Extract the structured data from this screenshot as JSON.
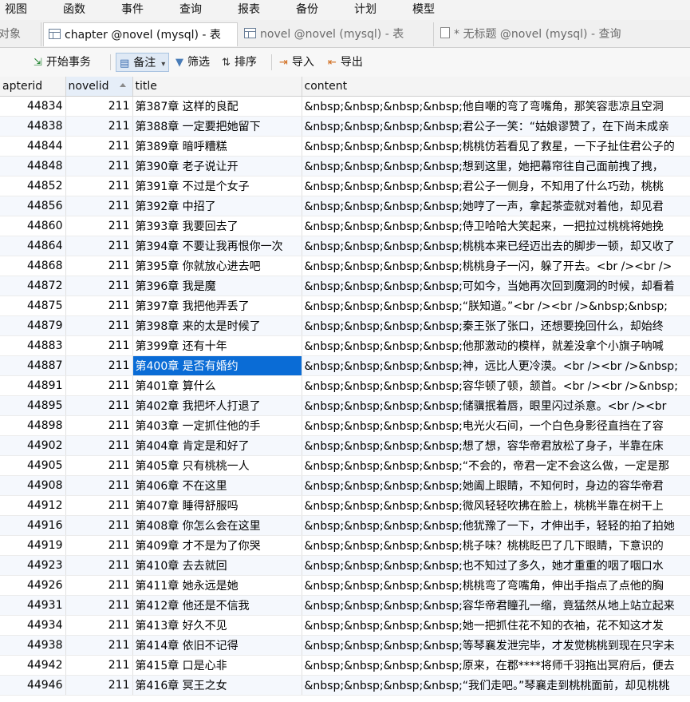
{
  "menu": [
    "视图",
    "函数",
    "事件",
    "查询",
    "报表",
    "备份",
    "计划",
    "模型"
  ],
  "tabs": [
    {
      "label": "对象",
      "icon": "objects-icon"
    },
    {
      "label": "chapter @novel (mysql) - 表",
      "icon": "table-icon"
    },
    {
      "label": "novel @novel (mysql) - 表",
      "icon": "table-icon"
    },
    {
      "label": "* 无标题 @novel (mysql) - 查询",
      "icon": "query-icon"
    }
  ],
  "toolbar": {
    "begin_transaction": "开始事务",
    "memo": "备注",
    "filter": "筛选",
    "sort": "排序",
    "import": "导入",
    "export": "导出"
  },
  "columns": [
    "apterid",
    "novelid",
    "title",
    "content"
  ],
  "rows": [
    {
      "chapterid": "44834",
      "novelid": "211",
      "title": "第387章 这样的良配",
      "content": "&nbsp;&nbsp;&nbsp;&nbsp;他自嘲的弯了弯嘴角，那笑容悲凉且空洞"
    },
    {
      "chapterid": "44838",
      "novelid": "211",
      "title": "第388章 一定要把她留下",
      "content": "&nbsp;&nbsp;&nbsp;&nbsp;君公子一笑：“姑娘谬赞了，在下尚未成亲"
    },
    {
      "chapterid": "44844",
      "novelid": "211",
      "title": "第389章 暗呼糟糕",
      "content": "&nbsp;&nbsp;&nbsp;&nbsp;桃桃仿若看见了救星，一下子扯住君公子的"
    },
    {
      "chapterid": "44848",
      "novelid": "211",
      "title": "第390章 老子说让开",
      "content": "&nbsp;&nbsp;&nbsp;&nbsp;想到这里，她把幕帘往自己面前拽了拽，"
    },
    {
      "chapterid": "44852",
      "novelid": "211",
      "title": "第391章 不过是个女子",
      "content": "&nbsp;&nbsp;&nbsp;&nbsp;君公子一侧身，不知用了什么巧劲，桃桃"
    },
    {
      "chapterid": "44856",
      "novelid": "211",
      "title": "第392章 中招了",
      "content": "&nbsp;&nbsp;&nbsp;&nbsp;她哼了一声，拿起茶壶就对着他，却见君"
    },
    {
      "chapterid": "44860",
      "novelid": "211",
      "title": "第393章 我要回去了",
      "content": "&nbsp;&nbsp;&nbsp;&nbsp;侍卫哈哈大笑起来，一把拉过桃桃将她挽"
    },
    {
      "chapterid": "44864",
      "novelid": "211",
      "title": "第394章 不要让我再恨你一次",
      "content": "&nbsp;&nbsp;&nbsp;&nbsp;桃桃本来已经迈出去的脚步一顿，却又收了"
    },
    {
      "chapterid": "44868",
      "novelid": "211",
      "title": "第395章 你就放心进去吧",
      "content": "&nbsp;&nbsp;&nbsp;&nbsp;桃桃身子一闪，躲了开去。<br /><br />"
    },
    {
      "chapterid": "44872",
      "novelid": "211",
      "title": "第396章 我是魔",
      "content": "&nbsp;&nbsp;&nbsp;&nbsp;可如今，当她再次回到魔洞的时候，却看着"
    },
    {
      "chapterid": "44875",
      "novelid": "211",
      "title": "第397章 我把他弄丢了",
      "content": "&nbsp;&nbsp;&nbsp;&nbsp;“朕知道。”<br /><br />&nbsp;&nbsp;"
    },
    {
      "chapterid": "44879",
      "novelid": "211",
      "title": "第398章 来的太是时候了",
      "content": "&nbsp;&nbsp;&nbsp;&nbsp;秦王张了张口，还想要挽回什么，却始终"
    },
    {
      "chapterid": "44883",
      "novelid": "211",
      "title": "第399章 还有十年",
      "content": "&nbsp;&nbsp;&nbsp;&nbsp;他那激动的模样，就差没拿个小旗子呐喊"
    },
    {
      "chapterid": "44887",
      "novelid": "211",
      "title": "第400章 是否有婚约",
      "content": "&nbsp;&nbsp;&nbsp;&nbsp;神，远比人更冷漠。<br /><br />&nbsp;"
    },
    {
      "chapterid": "44891",
      "novelid": "211",
      "title": "第401章 算什么",
      "content": "&nbsp;&nbsp;&nbsp;&nbsp;容华顿了顿，颔首。<br /><br />&nbsp;"
    },
    {
      "chapterid": "44895",
      "novelid": "211",
      "title": "第402章 我把坏人打退了",
      "content": "&nbsp;&nbsp;&nbsp;&nbsp;储骥抿着唇，眼里闪过杀意。<br /><br"
    },
    {
      "chapterid": "44898",
      "novelid": "211",
      "title": "第403章 一定抓住他的手",
      "content": "&nbsp;&nbsp;&nbsp;&nbsp;电光火石间，一个白色身影径直挡在了容"
    },
    {
      "chapterid": "44902",
      "novelid": "211",
      "title": "第404章 肯定是和好了",
      "content": "&nbsp;&nbsp;&nbsp;&nbsp;想了想，容华帝君放松了身子，半靠在床"
    },
    {
      "chapterid": "44905",
      "novelid": "211",
      "title": "第405章 只有桃桃一人",
      "content": "&nbsp;&nbsp;&nbsp;&nbsp;“不会的，帝君一定不会这么做，一定是那"
    },
    {
      "chapterid": "44908",
      "novelid": "211",
      "title": "第406章 不在这里",
      "content": "&nbsp;&nbsp;&nbsp;&nbsp;她阖上眼睛，不知何时，身边的容华帝君"
    },
    {
      "chapterid": "44912",
      "novelid": "211",
      "title": "第407章 睡得舒服吗",
      "content": "&nbsp;&nbsp;&nbsp;&nbsp;微风轻轻吹拂在脸上，桃桃半靠在树干上"
    },
    {
      "chapterid": "44916",
      "novelid": "211",
      "title": "第408章 你怎么会在这里",
      "content": "&nbsp;&nbsp;&nbsp;&nbsp;他犹豫了一下，才伸出手，轻轻的拍了拍她"
    },
    {
      "chapterid": "44919",
      "novelid": "211",
      "title": "第409章 才不是为了你哭",
      "content": "&nbsp;&nbsp;&nbsp;&nbsp;桃子味？桃桃眨巴了几下眼睛，下意识的"
    },
    {
      "chapterid": "44923",
      "novelid": "211",
      "title": "第410章 去去就回",
      "content": "&nbsp;&nbsp;&nbsp;&nbsp;也不知过了多久，她才重重的咽了咽口水"
    },
    {
      "chapterid": "44926",
      "novelid": "211",
      "title": "第411章 她永远是她",
      "content": "&nbsp;&nbsp;&nbsp;&nbsp;桃桃弯了弯嘴角，伸出手指点了点他的胸"
    },
    {
      "chapterid": "44931",
      "novelid": "211",
      "title": "第412章 他还是不信我",
      "content": "&nbsp;&nbsp;&nbsp;&nbsp;容华帝君瞳孔一缩，竟猛然从地上站立起来"
    },
    {
      "chapterid": "44934",
      "novelid": "211",
      "title": "第413章 好久不见",
      "content": "&nbsp;&nbsp;&nbsp;&nbsp;她一把抓住花不知的衣袖，花不知这才发"
    },
    {
      "chapterid": "44938",
      "novelid": "211",
      "title": "第414章 依旧不记得",
      "content": "&nbsp;&nbsp;&nbsp;&nbsp;等琴襄发泄完毕，才发觉桃桃到现在只字未"
    },
    {
      "chapterid": "44942",
      "novelid": "211",
      "title": "第415章 口是心非",
      "content": "&nbsp;&nbsp;&nbsp;&nbsp;原来，在郡****将师千羽拖出冥府后，便去"
    },
    {
      "chapterid": "44946",
      "novelid": "211",
      "title": "第416章 冥王之女",
      "content": "&nbsp;&nbsp;&nbsp;&nbsp;“我们走吧。”琴襄走到桃桃面前，却见桃桃"
    }
  ],
  "selected_row": 13,
  "colors": {
    "selection": "#0a6cd6",
    "alt_row": "#f5f8fd"
  }
}
